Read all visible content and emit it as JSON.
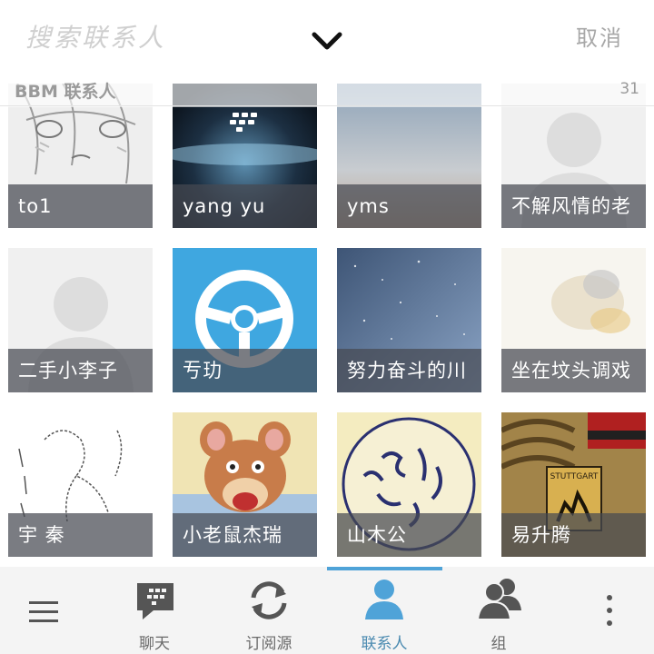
{
  "header": {
    "search_placeholder": "搜索联系人",
    "cancel_label": "取消",
    "collapse_icon": "chevron-down-icon"
  },
  "section": {
    "label": "BBM 联系人",
    "count": "31"
  },
  "contacts": [
    {
      "name": "to1",
      "avatar": "anime-sketch"
    },
    {
      "name": "yang yu",
      "avatar": "blackberry-horizon"
    },
    {
      "name": "yms",
      "avatar": "sky"
    },
    {
      "name": "不解风情的老",
      "avatar": "default-silhouette"
    },
    {
      "name": "二手小李子",
      "avatar": "default-silhouette"
    },
    {
      "name": "亐玏",
      "avatar": "steering-wheel"
    },
    {
      "name": "努力奋斗的川",
      "avatar": "starry-sky"
    },
    {
      "name": "坐在坟头调戏",
      "avatar": "blurred-art"
    },
    {
      "name": "宇 秦",
      "avatar": "line-drawing"
    },
    {
      "name": "小老鼠杰瑞",
      "avatar": "cartoon-mouse"
    },
    {
      "name": "山木公",
      "avatar": "tibetan-seal"
    },
    {
      "name": "易升腾",
      "avatar": "porsche-emblem"
    }
  ],
  "nav": {
    "menu_icon": "hamburger-menu-icon",
    "more_icon": "more-vertical-icon",
    "tabs": [
      {
        "label": "聊天",
        "icon": "bbm-chat-icon"
      },
      {
        "label": "订阅源",
        "icon": "sync-icon"
      },
      {
        "label": "联系人",
        "icon": "contact-person-icon"
      },
      {
        "label": "组",
        "icon": "group-icon"
      }
    ],
    "active_tab": "联系人"
  },
  "colors": {
    "accent": "#4fa3d8",
    "active_label": "#4a8ab0",
    "name_overlay": "#464a52",
    "bottombar_bg": "#f4f4f4"
  }
}
